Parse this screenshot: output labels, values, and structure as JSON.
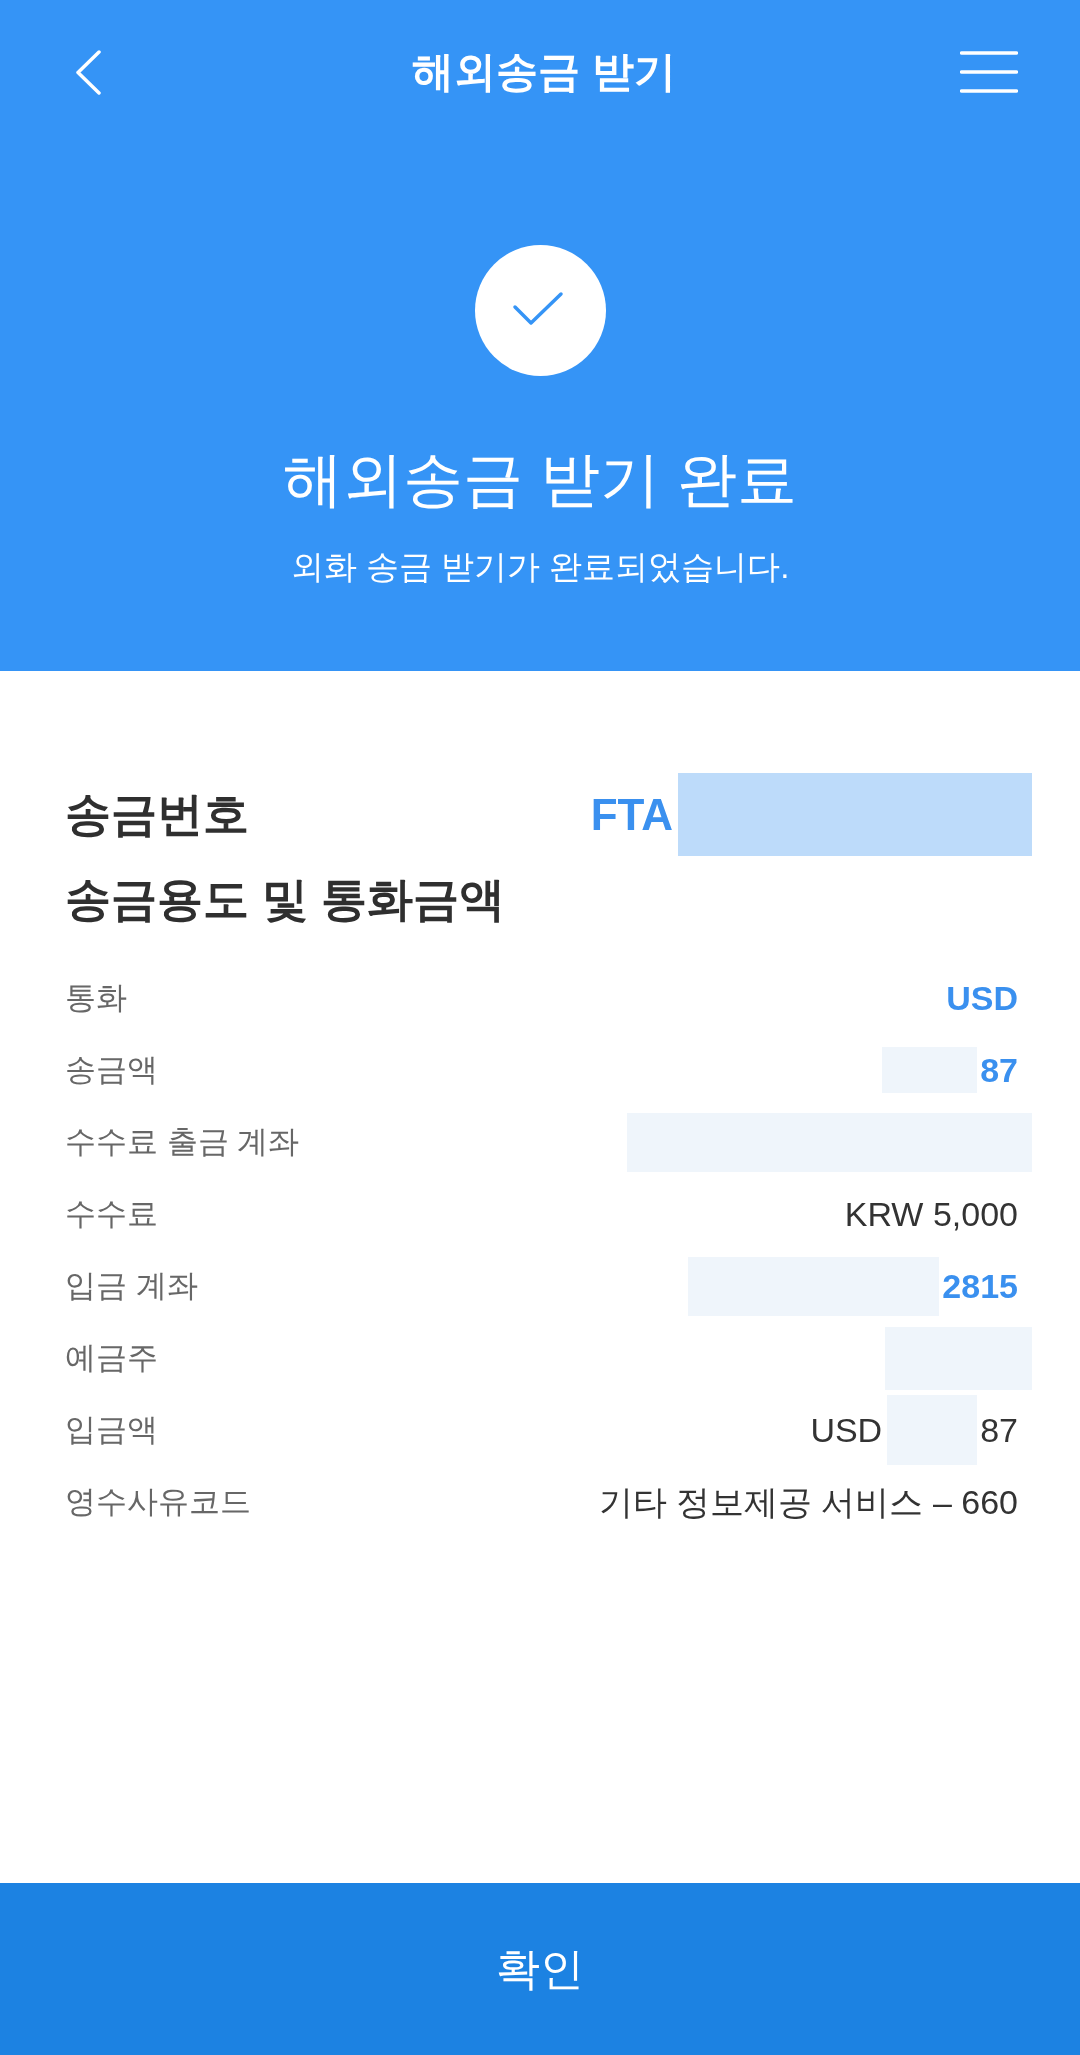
{
  "header": {
    "title": "해외송금 받기"
  },
  "result": {
    "title": "해외송금 받기 완료",
    "message": "외화 송금 받기가 완료되었습니다."
  },
  "remittance_number": {
    "label": "송금번호",
    "value_parts": [
      {
        "kind": "text",
        "text": "FTA",
        "emphasis": true
      },
      {
        "kind": "redaction"
      }
    ]
  },
  "section_title": "송금용도 및 통화금액",
  "details": [
    {
      "label": "통화",
      "value_parts": [
        {
          "kind": "text",
          "text": "USD",
          "emphasis": true
        }
      ]
    },
    {
      "label": "송금액",
      "value_parts": [
        {
          "kind": "redaction"
        },
        {
          "kind": "text",
          "text": "87",
          "emphasis": true
        }
      ]
    },
    {
      "label": "수수료 출금 계좌",
      "value_parts": [
        {
          "kind": "redaction"
        }
      ]
    },
    {
      "label": "수수료",
      "value_parts": [
        {
          "kind": "text",
          "text": "KRW 5,000",
          "emphasis": false
        }
      ]
    },
    {
      "label": "입금 계좌",
      "value_parts": [
        {
          "kind": "redaction"
        },
        {
          "kind": "text",
          "text": "2815",
          "emphasis": true
        }
      ]
    },
    {
      "label": "예금주",
      "value_parts": [
        {
          "kind": "redaction"
        }
      ]
    },
    {
      "label": "입금액",
      "value_parts": [
        {
          "kind": "text",
          "text": "USD",
          "emphasis": false
        },
        {
          "kind": "redaction"
        },
        {
          "kind": "text",
          "text": "87",
          "emphasis": false
        }
      ]
    },
    {
      "label": "영수사유코드",
      "value_parts": [
        {
          "kind": "text",
          "text": "기타 정보제공 서비스 – 660",
          "emphasis": false
        }
      ]
    }
  ],
  "confirm_button": {
    "label": "확인"
  }
}
